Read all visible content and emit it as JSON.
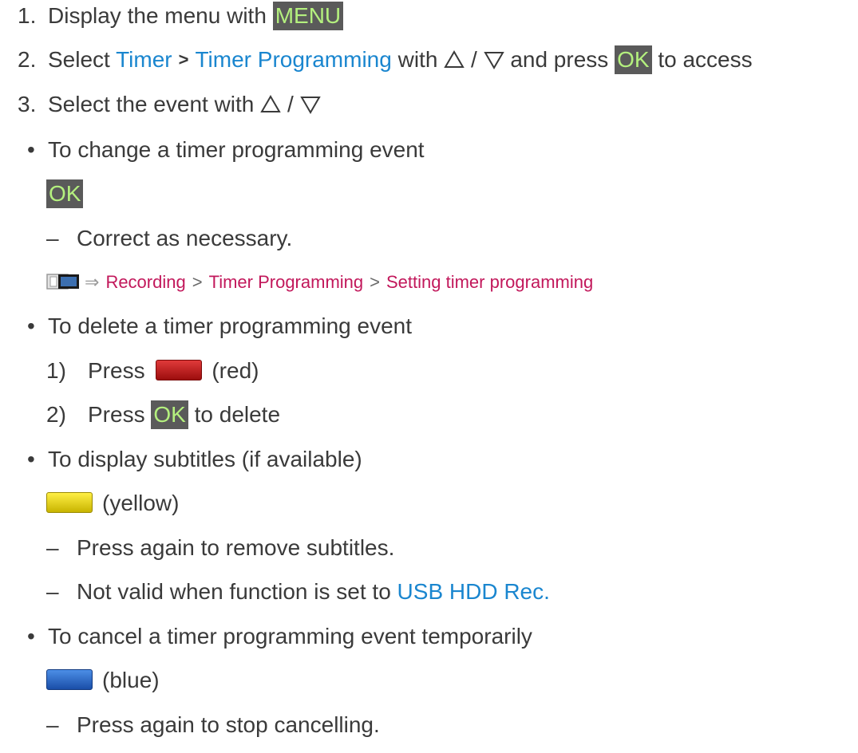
{
  "step1": {
    "num": "1.",
    "text": "Display the menu with",
    "key": "MENU"
  },
  "step2": {
    "num": "2.",
    "text": "Select",
    "link1": "Timer",
    "sep": ">",
    "link2": "Timer Programming",
    "with": "with",
    "slash": "/",
    "and_press": "and press",
    "key": "OK",
    "tail": "to access"
  },
  "step3": {
    "num": "3.",
    "text": "Select the event with",
    "slash": "/"
  },
  "change": {
    "bullet": "•",
    "text": "To change a timer programming event",
    "key": "OK",
    "dash": "–",
    "note": "Correct as necessary.",
    "ref": {
      "arrow": "⇒",
      "part1": "Recording",
      "sep": ">",
      "part2": "Timer Programming",
      "part3": "Setting timer programming"
    }
  },
  "delete": {
    "bullet": "•",
    "text": "To delete a timer programming event",
    "sub1": {
      "num": "1)",
      "text": "Press",
      "color_name": "(red)"
    },
    "sub2": {
      "num": "2)",
      "text": "Press",
      "key": "OK",
      "tail": "to delete"
    }
  },
  "subtitles": {
    "bullet": "•",
    "text": "To display subtitles (if available)",
    "color_name": "(yellow)",
    "dash": "–",
    "note1": "Press again to remove subtitles.",
    "note2": "Not valid when function is set to",
    "note2_link": "USB HDD Rec."
  },
  "cancel": {
    "bullet": "•",
    "text": "To cancel a timer programming event temporarily",
    "color_name": "(blue)",
    "dash": "–",
    "note": "Press again to stop cancelling."
  },
  "colors": {
    "key_bg": "#5a5a5a",
    "key_text": "#b4f07e",
    "link": "#1a86cf",
    "ref": "#c2185b",
    "red": "#c01818",
    "yellow": "#f0dc00",
    "blue": "#2e6cc8"
  }
}
